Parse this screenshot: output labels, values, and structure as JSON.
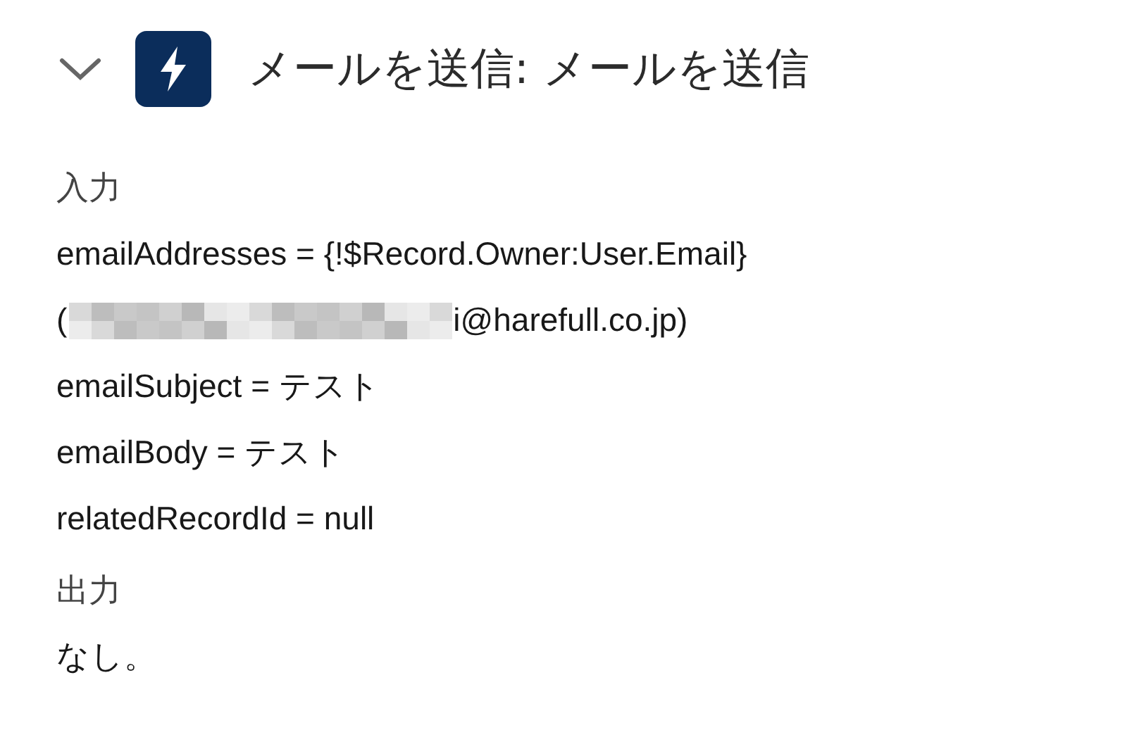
{
  "header": {
    "title": "メールを送信: メールを送信",
    "expanded": true
  },
  "sections": [
    {
      "heading": "入力",
      "lines": [
        {
          "kind": "text",
          "text": "emailAddresses = {!$Record.Owner:User.Email}"
        },
        {
          "kind": "redacted",
          "before": "(",
          "after": "i@harefull.co.jp)"
        },
        {
          "kind": "text",
          "text": "emailSubject = テスト"
        },
        {
          "kind": "text",
          "text": "emailBody = テスト"
        },
        {
          "kind": "text",
          "text": "relatedRecordId = null"
        }
      ]
    },
    {
      "heading": "出力",
      "lines": [
        {
          "kind": "text",
          "text": "なし。"
        }
      ]
    }
  ]
}
